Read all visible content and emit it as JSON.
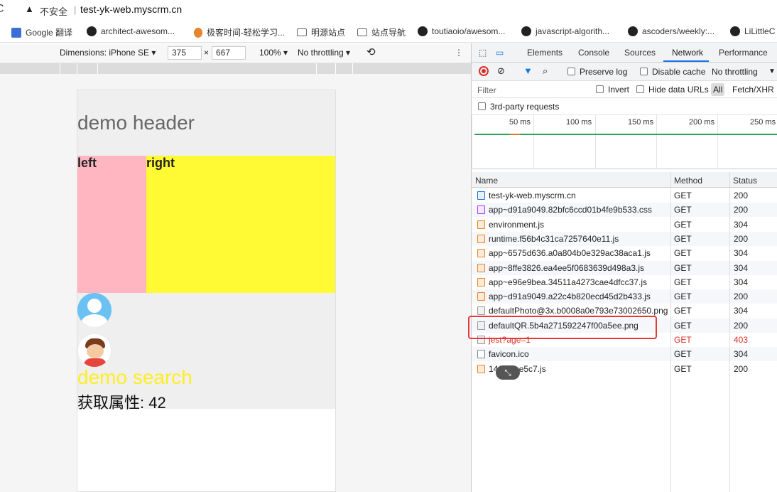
{
  "address": {
    "insecure_label": "不安全",
    "separator": "|",
    "url": "test-yk-web.myscrm.cn"
  },
  "bookmarks": [
    {
      "label": "Google 翻译",
      "icon": "google-translate-icon"
    },
    {
      "label": "architect-awesom...",
      "icon": "github-icon"
    },
    {
      "label": "极客时间-轻松学习...",
      "icon": "geektime-icon"
    },
    {
      "label": "明源站点",
      "icon": "folder-icon"
    },
    {
      "label": "站点导航",
      "icon": "folder-icon"
    },
    {
      "label": "toutiaoio/awesom...",
      "icon": "github-icon"
    },
    {
      "label": "javascript-algorith...",
      "icon": "github-icon"
    },
    {
      "label": "ascoders/weekly:...",
      "icon": "github-icon"
    },
    {
      "label": "LiLittleC",
      "icon": "github-icon"
    }
  ],
  "device_toolbar": {
    "dimensions": "Dimensions: iPhone SE ▾",
    "width": "375",
    "times": "×",
    "height": "667",
    "zoom": "100% ▾",
    "throttle": "No throttling ▾",
    "more": "⋮"
  },
  "page": {
    "header": "demo header",
    "left": "left",
    "right": "right",
    "search": "demo search",
    "attr": "获取属性: 42"
  },
  "devtools": {
    "tabs": [
      "Elements",
      "Console",
      "Sources",
      "Network",
      "Performance"
    ],
    "active_tab": "Network",
    "preserve_log": "Preserve log",
    "disable_cache": "Disable cache",
    "throttling": "No throttling",
    "filter_placeholder": "Filter",
    "invert": "Invert",
    "hide_data_urls": "Hide data URLs",
    "all": "All",
    "fetch_xhr": "Fetch/XHR",
    "third_party": "3rd-party requests",
    "timeline_labels": [
      "50 ms",
      "100 ms",
      "150 ms",
      "200 ms",
      "250 ms"
    ],
    "columns": [
      "Name",
      "Method",
      "Status"
    ],
    "requests": [
      {
        "name": "test-yk-web.myscrm.cn",
        "method": "GET",
        "status": "200",
        "type": "doc"
      },
      {
        "name": "app~d91a9049.82bfc6ccd01b4fe9b533.css",
        "method": "GET",
        "status": "200",
        "type": "css"
      },
      {
        "name": "environment.js",
        "method": "GET",
        "status": "304",
        "type": "js"
      },
      {
        "name": "runtime.f56b4c31ca7257640e11.js",
        "method": "GET",
        "status": "200",
        "type": "js"
      },
      {
        "name": "app~6575d636.a0a804b0e329ac38aca1.js",
        "method": "GET",
        "status": "304",
        "type": "js"
      },
      {
        "name": "app~8ffe3826.ea4ee5f0683639d498a3.js",
        "method": "GET",
        "status": "304",
        "type": "js"
      },
      {
        "name": "app~e96e9bea.34511a4273cae4dfcc37.js",
        "method": "GET",
        "status": "304",
        "type": "js"
      },
      {
        "name": "app~d91a9049.a22c4b820ecd45d2b433.js",
        "method": "GET",
        "status": "200",
        "type": "js"
      },
      {
        "name": "defaultPhoto@3x.b0008a0e793e73002650.png",
        "method": "GET",
        "status": "304",
        "type": "img"
      },
      {
        "name": "defaultQR.5b4a271592247f00a5ee.png",
        "method": "GET",
        "status": "200",
        "type": "img"
      },
      {
        "name": "jest?age=1",
        "method": "GET",
        "status": "403",
        "type": "err"
      },
      {
        "name": "favicon.ico",
        "method": "GET",
        "status": "304",
        "type": "plain"
      },
      {
        "name": "141f27ce5c7.js",
        "method": "GET",
        "status": "200",
        "type": "js"
      }
    ],
    "pager_label": "⤡"
  }
}
